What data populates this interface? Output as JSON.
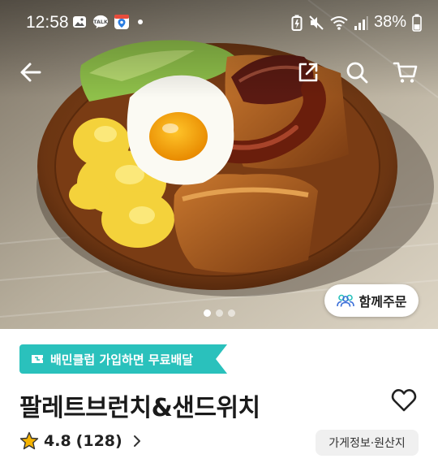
{
  "status_bar": {
    "time": "12:58",
    "battery_percent": "38%",
    "icons_left": [
      "gallery-icon",
      "talk-icon",
      "maps-icon",
      "notification-dot"
    ],
    "icons_right": [
      "battery-saver-icon",
      "mute-icon",
      "wifi-icon",
      "signal-icon",
      "battery-icon"
    ]
  },
  "app_bar": {
    "icons": [
      "back-arrow-icon",
      "share-icon",
      "search-icon",
      "cart-icon"
    ]
  },
  "hero": {
    "carousel": {
      "total": 3,
      "active_index": 0
    },
    "group_order_label": "함께주문"
  },
  "store": {
    "promo_label": "배민클럽 가입하면 무료배달",
    "name": "팔레트브런치&샌드위치",
    "rating": "4.8",
    "review_count": "(128)",
    "info_button_label": "가게정보·원산지"
  },
  "colors": {
    "promo_bg": "#2ac1bc",
    "star": "#f5b301",
    "title_text": "#1a1a1a"
  }
}
